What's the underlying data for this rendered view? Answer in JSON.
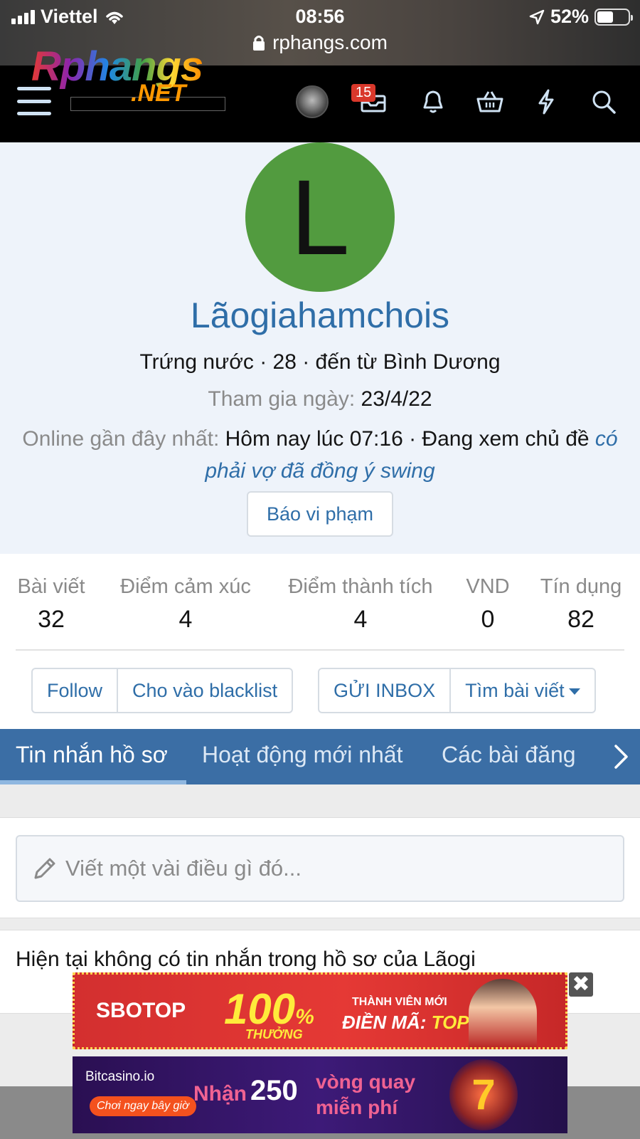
{
  "status_bar": {
    "carrier": "Viettel",
    "time": "08:56",
    "battery": "52%",
    "battery_level": 0.52
  },
  "browser": {
    "url": "rphangs.com"
  },
  "header": {
    "logo_main": "Rphangs",
    "logo_sub": ".NET",
    "inbox_badge": "15",
    "icons": [
      "menu-icon",
      "avatar",
      "inbox-icon",
      "bell-icon",
      "basket-icon",
      "lightning-icon",
      "search-icon"
    ]
  },
  "profile": {
    "avatar_letter": "L",
    "avatar_color": "#529b3f",
    "username": "Lãogiahamchois",
    "subtitle": "Trứng nước · 28 · đến từ Bình Dương",
    "joined_label": "Tham gia ngày:",
    "joined_value": "23/4/22",
    "online_label": "Online gần đây nhất:",
    "online_value": "Hôm nay lúc 07:16 · Đang xem chủ đề",
    "online_link": "có phải vợ đã đồng ý swing",
    "report_button": "Báo vi phạm"
  },
  "stats": [
    {
      "label": "Bài viết",
      "value": "32"
    },
    {
      "label": "Điểm cảm xúc",
      "value": "4"
    },
    {
      "label": "Điểm thành tích",
      "value": "4"
    },
    {
      "label": "VND",
      "value": "0"
    },
    {
      "label": "Tín dụng",
      "value": "82"
    }
  ],
  "actions": {
    "follow": "Follow",
    "blacklist": "Cho vào blacklist",
    "inbox": "GỬI INBOX",
    "find_posts": "Tìm bài viết"
  },
  "tabs": [
    {
      "label": "Tin nhắn hồ sơ",
      "active": true
    },
    {
      "label": "Hoạt động mới nhất",
      "active": false
    },
    {
      "label": "Các bài đăng",
      "active": false
    }
  ],
  "composer": {
    "placeholder": "Viết một vài điều gì đó..."
  },
  "message": {
    "text": "Hiện tại không có tin nhắn trong hồ sơ của Lãogi"
  },
  "ads": {
    "ad1": {
      "brand": "SBOTOP",
      "big": "100",
      "percent": "%",
      "bonus": "THƯỞNG",
      "member": "THÀNH VIÊN MỚI",
      "code_label": "ĐIỀN MÃ:",
      "code": "TOP"
    },
    "ad2": {
      "brand": "Bitcasino.io",
      "cta": "Chơi ngay bây giờ",
      "prefix": "Nhận",
      "amount": "250",
      "line1": "vòng quay",
      "line2": "miễn phí",
      "symbol": "7"
    },
    "close": "✖"
  },
  "colors": {
    "accent": "#2f6ea8",
    "tab_bar": "#3b6ea5",
    "badge": "#d9382b"
  }
}
